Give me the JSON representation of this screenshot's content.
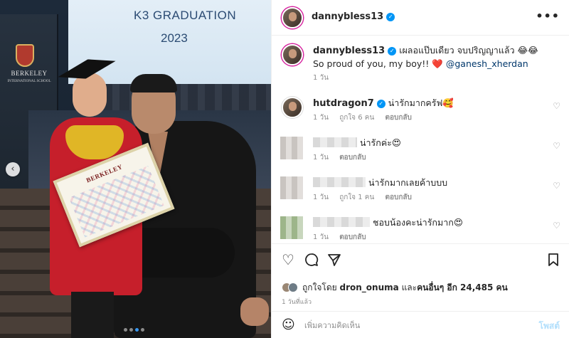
{
  "photo": {
    "screen_line1": "K3 GRADUATION",
    "screen_line2": "2023",
    "podium_name": "BERKELEY",
    "podium_sub": "INTERNATIONAL SCHOOL",
    "certificate_title": "BERKELEY",
    "carousel_prev_glyph": "‹",
    "dots_count": 4,
    "active_dot_index": 2
  },
  "header": {
    "username": "dannybless13",
    "more_glyph": "•••"
  },
  "caption": {
    "username": "dannybless13",
    "text_line1": "เผลอแป๊บเดียว จบปริญญาแล้ว 😂😂",
    "text_line2_prefix": "So proud of you, my boy!! ",
    "heart": "❤️",
    "mention": "@ganesh_xherdan",
    "time": "1 วัน"
  },
  "comments": [
    {
      "username": "hutdragon7",
      "verified": true,
      "text": "น่ารักมากครัฟ🥰",
      "time": "1 วัน",
      "likes": "ถูกใจ 6 คน",
      "reply": "ตอบกลับ"
    },
    {
      "username": "",
      "verified": false,
      "text": "น่ารักค่ะ😍",
      "time": "1 วัน",
      "likes": "",
      "reply": "ตอบกลับ"
    },
    {
      "username": "",
      "verified": false,
      "text": "น่ารักมากเลยค้าบบบ",
      "time": "1 วัน",
      "likes": "ถูกใจ 1 คน",
      "reply": "ตอบกลับ"
    },
    {
      "username": "",
      "verified": false,
      "text": "ชอบน้องคะน่ารักมาก😍",
      "time": "1 วัน",
      "likes": "",
      "reply": "ตอบกลับ"
    }
  ],
  "actions": {
    "like_icon": "heart-icon",
    "comment_icon": "comment-icon",
    "share_icon": "share-icon",
    "save_icon": "bookmark-icon"
  },
  "likes": {
    "prefix": "ถูกใจโดย ",
    "user": "dron_onuma",
    "middle": " และ",
    "others": "คนอื่นๆ อีก 24,485 คน"
  },
  "posted_time": "1 วันที่แล้ว",
  "add_comment": {
    "placeholder": "เพิ่มความคิดเห็น",
    "post_label": "โพสต์"
  },
  "colors": {
    "verified": "#0095f6",
    "mention": "#00376b",
    "post_button_disabled": "#b2dffc",
    "active_dot": "#3897f0"
  }
}
